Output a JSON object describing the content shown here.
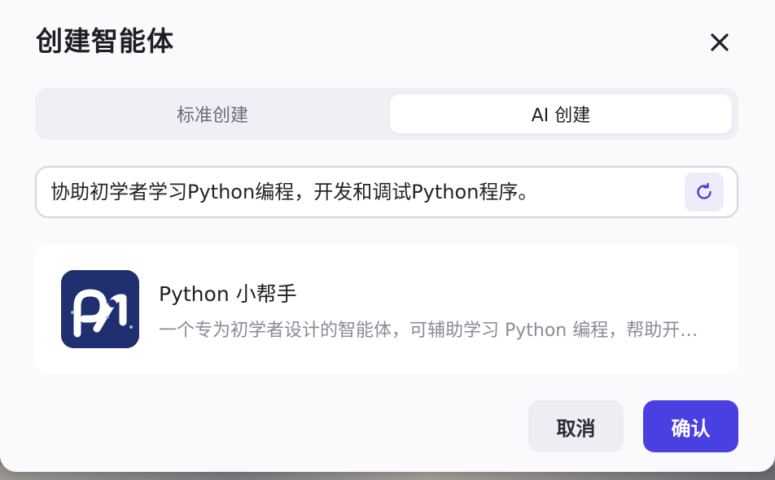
{
  "dialog": {
    "title": "创建智能体",
    "close_icon": "close-icon"
  },
  "tabs": [
    {
      "label": "标准创建",
      "active": false
    },
    {
      "label": "AI 创建",
      "active": true
    }
  ],
  "prompt": {
    "value": "协助初学者学习Python编程，开发和调试Python程序。",
    "refresh_icon": "refresh-icon"
  },
  "result": {
    "name": "Python 小帮手",
    "description": "一个专为初学者设计的智能体，可辅助学习 Python 编程，帮助开发和调试 Python 程序。",
    "avatar_icon": "python-helper-logo"
  },
  "actions": {
    "cancel_label": "取消",
    "confirm_label": "确认"
  },
  "colors": {
    "accent": "#4a3fe0",
    "avatar_bg": "#1f2f70"
  }
}
